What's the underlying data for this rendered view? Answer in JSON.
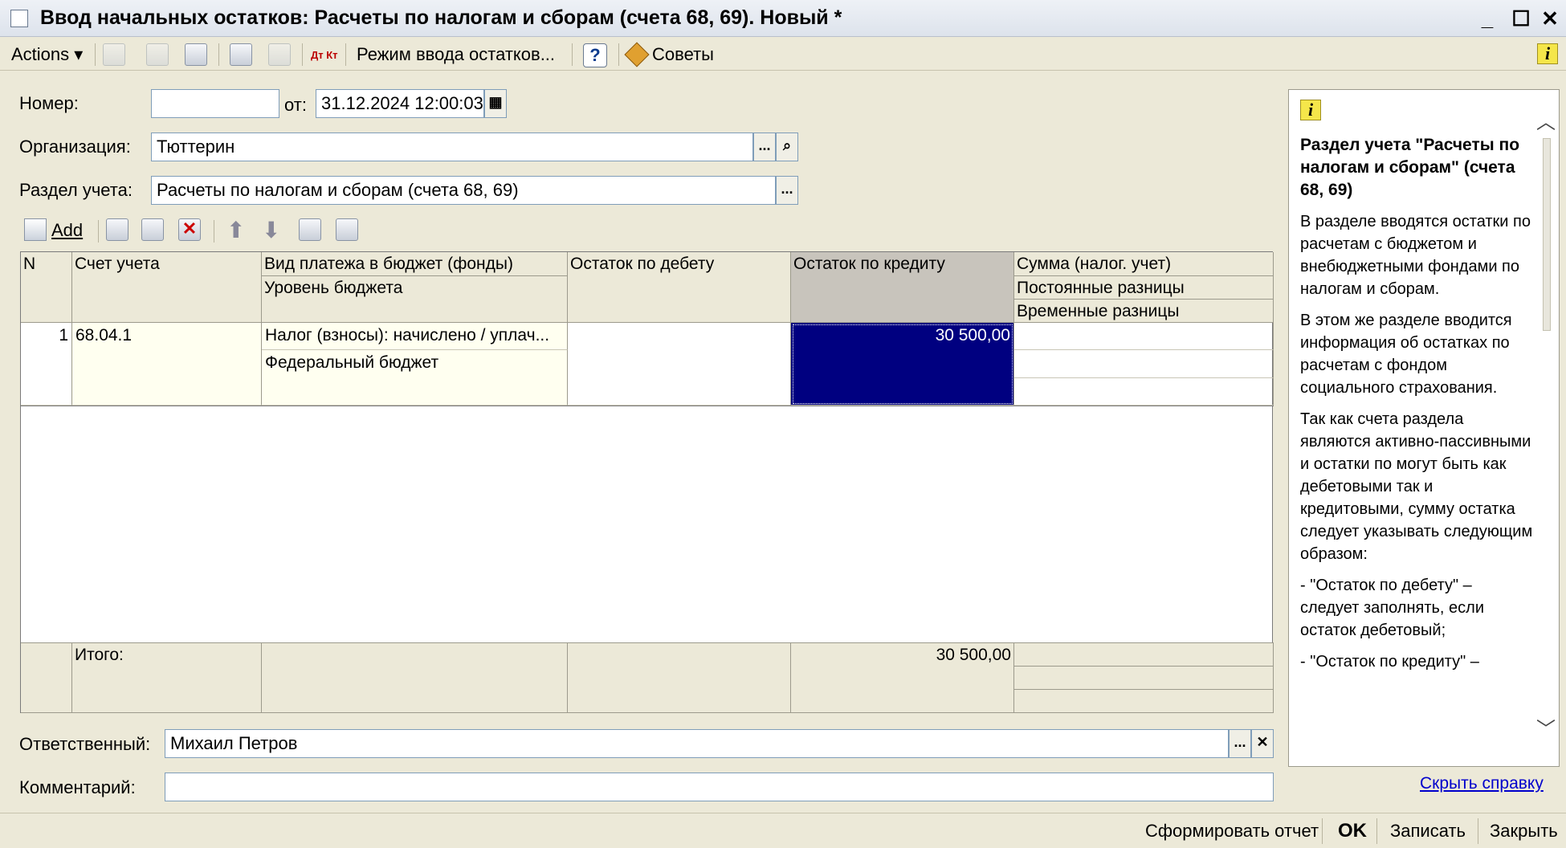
{
  "window": {
    "title": "Ввод начальных остатков: Расчеты по налогам и сборам (счета 68, 69). Новый *"
  },
  "toolbar": {
    "actions": "Actions",
    "mode_input": "Режим ввода остатков...",
    "help": "?",
    "tips": "Советы",
    "dtkt": "Дт Кт"
  },
  "form": {
    "number_label": "Номер:",
    "number_value": "",
    "date_label": "от:",
    "date_value": "31.12.2024 12:00:03",
    "org_label": "Организация:",
    "org_value": "Тюттерин",
    "section_label": "Раздел учета:",
    "section_value": "Расчеты по налогам и сборам (счета 68, 69)",
    "responsible_label": "Ответственный:",
    "responsible_value": "Михаил Петров",
    "comment_label": "Комментарий:",
    "comment_value": ""
  },
  "table_toolbar": {
    "add": "Add"
  },
  "table": {
    "headers": {
      "n": "N",
      "account": "Счет учета",
      "payment_type": "Вид платежа в бюджет (фонды)",
      "budget_level": "Уровень бюджета",
      "debit": "Остаток по дебету",
      "credit": "Остаток по кредиту",
      "sum_tax": "Сумма (налог. учет)",
      "permanent_diff": "Постоянные разницы",
      "temporary_diff": "Временные разницы"
    },
    "rows": [
      {
        "n": "1",
        "account": "68.04.1",
        "payment_type": "Налог (взносы): начислено / уплач...",
        "budget_level": "Федеральный бюджет",
        "debit": "",
        "credit": "30 500,00",
        "sum_tax": "",
        "permanent_diff": "",
        "temporary_diff": ""
      }
    ],
    "totals": {
      "label": "Итого:",
      "credit": "30 500,00"
    }
  },
  "help": {
    "title": "Раздел учета \"Расчеты по налогам и сборам\" (счета 68, 69)",
    "p1": "В разделе вводятся остатки по расчетам с бюджетом и внебюджетными фондами по налогам и сборам.",
    "p2": "В этом же разделе вводится информация об остатках по расчетам с фондом социального страхования.",
    "p3": "Так как счета раздела являются активно-пассивными и остатки по могут быть как дебетовыми так и кредитовыми, сумму остатка следует указывать следующим образом:",
    "p4": "- \"Остаток по дебету\" – следует заполнять, если остаток дебетовый;",
    "p5": "- \"Остаток по кредиту\" –",
    "hide_link": "Скрыть справку"
  },
  "bottom": {
    "report": "Сформировать отчет",
    "ok": "OK",
    "save": "Записать",
    "close": "Закрыть"
  },
  "colors": {
    "selection": "#000080",
    "link": "#0000cc"
  }
}
